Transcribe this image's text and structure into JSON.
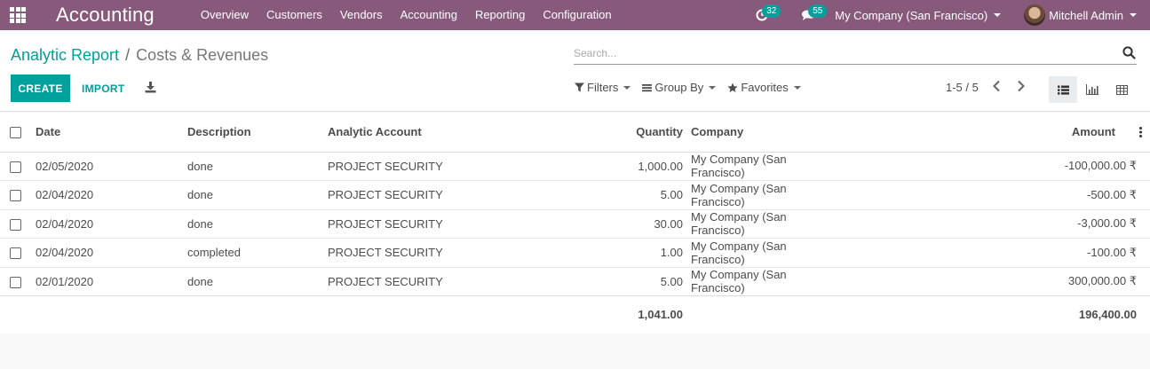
{
  "navbar": {
    "app_name": "Accounting",
    "menu": [
      "Overview",
      "Customers",
      "Vendors",
      "Accounting",
      "Reporting",
      "Configuration"
    ],
    "activity_count": "32",
    "messages_count": "55",
    "company": "My Company (San Francisco)",
    "user": "Mitchell Admin"
  },
  "breadcrumb": {
    "parent": "Analytic Report",
    "separator": "/",
    "current": "Costs & Revenues"
  },
  "search": {
    "placeholder": "Search..."
  },
  "buttons": {
    "create": "CREATE",
    "import": "IMPORT"
  },
  "search_options": {
    "filters": "Filters",
    "group_by": "Group By",
    "favorites": "Favorites"
  },
  "pager": {
    "value": "1-5 / 5"
  },
  "table": {
    "headers": {
      "date": "Date",
      "description": "Description",
      "analytic_account": "Analytic Account",
      "quantity": "Quantity",
      "company": "Company",
      "amount": "Amount"
    },
    "rows": [
      {
        "date": "02/05/2020",
        "description": "done",
        "analytic_account": "PROJECT SECURITY",
        "quantity": "1,000.00",
        "company": "My Company (San Francisco)",
        "amount": "-100,000.00 ₹"
      },
      {
        "date": "02/04/2020",
        "description": "done",
        "analytic_account": "PROJECT SECURITY",
        "quantity": "5.00",
        "company": "My Company (San Francisco)",
        "amount": "-500.00 ₹"
      },
      {
        "date": "02/04/2020",
        "description": "done",
        "analytic_account": "PROJECT SECURITY",
        "quantity": "30.00",
        "company": "My Company (San Francisco)",
        "amount": "-3,000.00 ₹"
      },
      {
        "date": "02/04/2020",
        "description": "completed",
        "analytic_account": "PROJECT SECURITY",
        "quantity": "1.00",
        "company": "My Company (San Francisco)",
        "amount": "-100.00 ₹"
      },
      {
        "date": "02/01/2020",
        "description": "done",
        "analytic_account": "PROJECT SECURITY",
        "quantity": "5.00",
        "company": "My Company (San Francisco)",
        "amount": "300,000.00 ₹"
      }
    ],
    "totals": {
      "quantity": "1,041.00",
      "amount": "196,400.00"
    }
  },
  "colors": {
    "brand": "#875a7b",
    "accent": "#00a09d"
  }
}
